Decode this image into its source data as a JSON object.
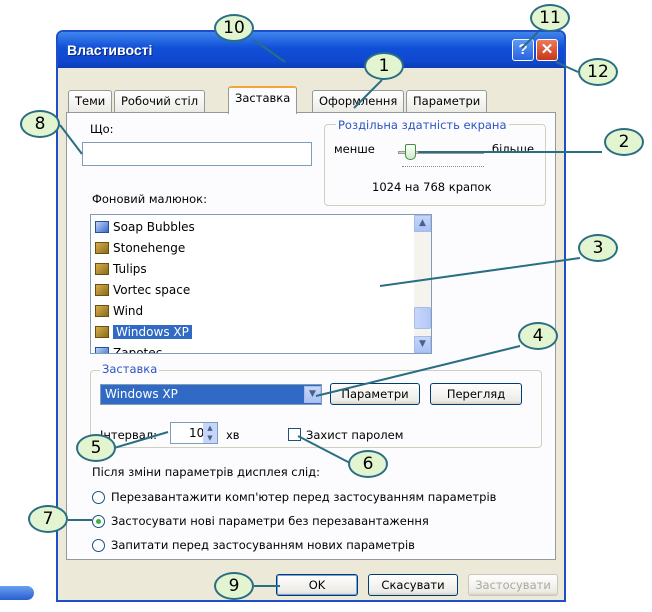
{
  "window": {
    "title": "Властивості"
  },
  "tabs": [
    "Теми",
    "Робочий стіл",
    "Заставка",
    "Оформлення",
    "Параметри"
  ],
  "what_label": "Що:",
  "what_value": "",
  "resolution": {
    "title": "Роздільна здатність екрана",
    "less": "менше",
    "more": "більше",
    "value_text": "1024 на 768 крапок"
  },
  "wallpaper_label": "Фоновий малюнок:",
  "wallpapers": [
    "Soap Bubbles",
    "Stonehenge",
    "Tulips",
    "Vortec space",
    "Wind",
    "Windows XP",
    "Zapotec"
  ],
  "selected_wallpaper": "Windows XP",
  "screensaver": {
    "title": "Заставка",
    "selected": "Windows XP",
    "settings_button": "Параметри",
    "preview_button": "Перегляд",
    "interval_label": "Інтервал:",
    "interval_value": "10",
    "interval_unit": "хв",
    "password_label": "Захист паролем"
  },
  "after_change_label": "Після зміни параметрів дисплея слід:",
  "options": [
    "Перезавантажити комп'ютер перед застосуванням параметрів",
    "Застосувати нові параметри без перезавантаження",
    "Запитати перед застосуванням нових параметрів"
  ],
  "selected_option": 1,
  "buttons": {
    "ok": "OK",
    "cancel": "Скасувати",
    "apply": "Застосувати"
  },
  "callouts": [
    "1",
    "2",
    "3",
    "4",
    "5",
    "6",
    "7",
    "8",
    "9",
    "10",
    "11",
    "12"
  ],
  "colors": {
    "title_bar": "#0f4fd7",
    "callout_fill": "#e2f4d0",
    "callout_border": "#2a6e83",
    "selection": "#316ac5"
  }
}
